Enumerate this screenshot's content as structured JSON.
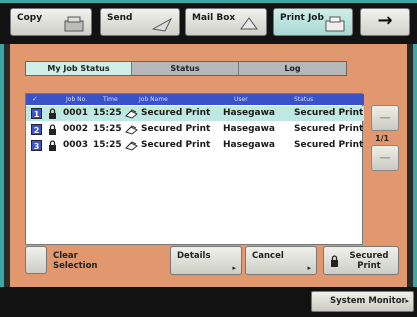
{
  "topbar": {
    "copy": "Copy",
    "send": "Send",
    "mailbox": "Mail Box",
    "printjob": "Print Job",
    "arrow": "→"
  },
  "tabs": [
    "My Job Status",
    "Status",
    "Log"
  ],
  "table": {
    "headers": {
      "check": "✓",
      "jobno": "Job No.",
      "time": "Time",
      "jobname": "Job Name",
      "user": "User",
      "status": "Status"
    },
    "rows": [
      {
        "index": "1",
        "jobno": "0001",
        "time": "15:25",
        "jobname": "Secured Print",
        "user": "Hasegawa",
        "status": "Secured Print",
        "selected": true
      },
      {
        "index": "2",
        "jobno": "0002",
        "time": "15:25",
        "jobname": "Secured Print",
        "user": "Hasegawa",
        "status": "Secured Print",
        "selected": false
      },
      {
        "index": "3",
        "jobno": "0003",
        "time": "15:25",
        "jobname": "Secured Print",
        "user": "Hasegawa",
        "status": "Secured Print",
        "selected": false
      }
    ]
  },
  "pager": {
    "count": "1/1"
  },
  "buttons": {
    "clear_line1": "Clear",
    "clear_line2": "Selection",
    "details": "Details",
    "cancel": "Cancel",
    "secured_line1": "Secured",
    "secured_line2": "Print"
  },
  "system_monitor": "System Monitor",
  "colors": {
    "panel": "#e2986e",
    "accent_teal": "#3ea6a0",
    "header_blue": "#3a52c8"
  }
}
